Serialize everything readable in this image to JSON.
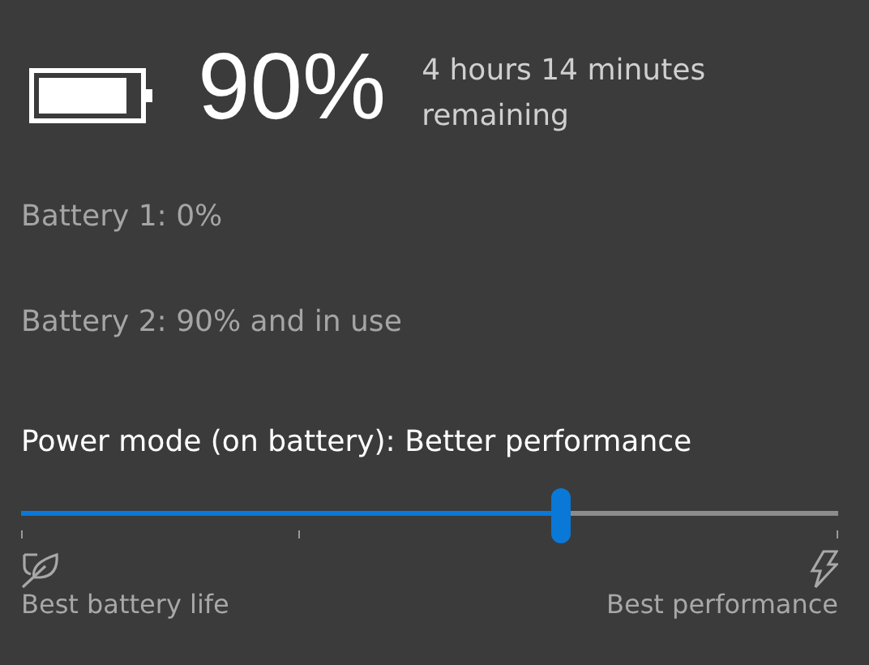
{
  "charge": {
    "percent": "90%",
    "remaining": "4 hours 14 minutes remaining"
  },
  "batteries": [
    "Battery 1: 0%",
    "Battery 2: 90% and in use"
  ],
  "power_mode": {
    "label": "Power mode (on battery): Better performance",
    "level": 0.66,
    "min_label": "Best battery life",
    "max_label": "Best performance"
  }
}
